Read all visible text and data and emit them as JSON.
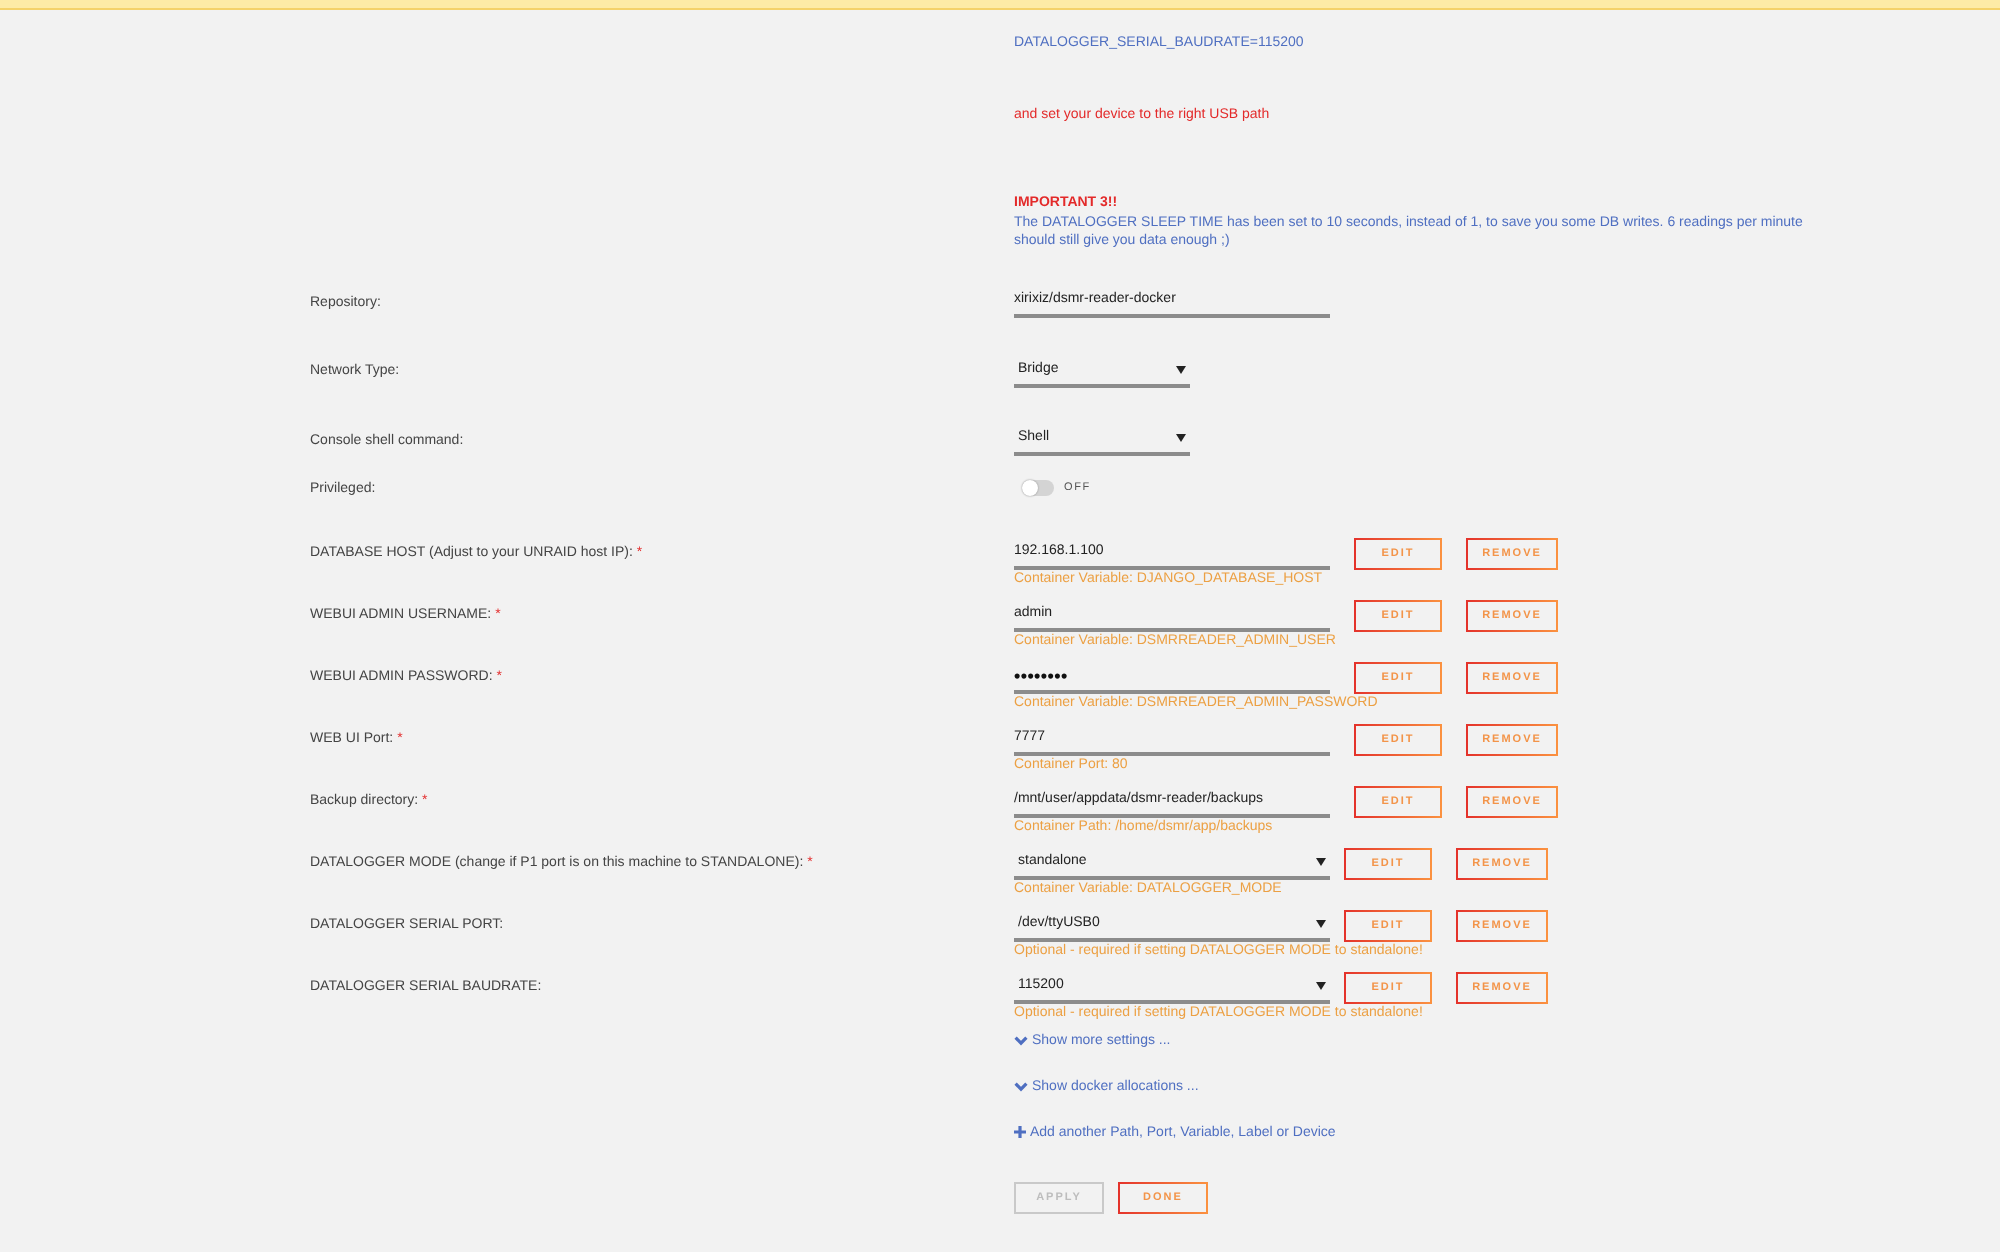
{
  "notes": [
    {
      "kind": "setting",
      "text": "DATALOGGER_SERIAL_BAUDRATE=115200"
    },
    {
      "kind": "warning",
      "text": "and set your device to the right USB path"
    },
    {
      "kind": "heading",
      "text": "IMPORTANT 3!!"
    },
    {
      "kind": "text",
      "text": "The DATALOGGER SLEEP TIME has been set to 10 seconds, instead of 1, to save you some DB writes. 6 readings per minute should still give you data enough ;)"
    }
  ],
  "settings": [
    {
      "label": "Repository:",
      "kind": "text",
      "value": "xirixiz/dsmr-reader-docker"
    },
    {
      "label": "Network Type:",
      "kind": "select",
      "value": "Bridge"
    },
    {
      "label": "Console shell command:",
      "kind": "select",
      "value": "Shell"
    },
    {
      "label": "Privileged:",
      "kind": "toggle",
      "on": false,
      "state_label": "OFF"
    }
  ],
  "variables": [
    {
      "label": "DATABASE HOST (Adjust to your UNRAID host IP):",
      "required_mark": "*",
      "kind": "text",
      "value": "192.168.1.100",
      "note": "Container Variable: DJANGO_DATABASE_HOST",
      "buttons": [
        "EDIT",
        "REMOVE"
      ]
    },
    {
      "label": "WEBUI ADMIN USERNAME:",
      "required_mark": "*",
      "kind": "text",
      "value": "admin",
      "note": "Container Variable: DSMRREADER_ADMIN_USER",
      "buttons": [
        "EDIT",
        "REMOVE"
      ]
    },
    {
      "label": "WEBUI ADMIN PASSWORD:",
      "required_mark": "*",
      "kind": "password",
      "value": "••••••••",
      "note": "Container Variable: DSMRREADER_ADMIN_PASSWORD",
      "buttons": [
        "EDIT",
        "REMOVE"
      ]
    },
    {
      "label": "WEB UI Port:",
      "required_mark": "*",
      "kind": "text",
      "value": "7777",
      "note": "Container Port: 80",
      "buttons": [
        "EDIT",
        "REMOVE"
      ]
    },
    {
      "label": "Backup directory:",
      "required_mark": "*",
      "kind": "text",
      "value": "/mnt/user/appdata/dsmr-reader/backups",
      "note": "Container Path: /home/dsmr/app/backups",
      "buttons": [
        "EDIT",
        "REMOVE"
      ]
    },
    {
      "label": "DATALOGGER MODE (change if P1 port is on this machine to STANDALONE):",
      "required_mark": "*",
      "kind": "select",
      "value": "standalone",
      "note": "Container Variable: DATALOGGER_MODE",
      "buttons": [
        "EDIT",
        "REMOVE"
      ]
    },
    {
      "label": "DATALOGGER SERIAL PORT:",
      "kind": "select",
      "value": "/dev/ttyUSB0",
      "note": "Optional - required if setting DATALOGGER MODE to standalone!",
      "buttons": [
        "EDIT",
        "REMOVE"
      ]
    },
    {
      "label": "DATALOGGER SERIAL BAUDRATE:",
      "kind": "select",
      "value": "115200",
      "note": "Optional - required if setting DATALOGGER MODE to standalone!",
      "buttons": [
        "EDIT",
        "REMOVE"
      ]
    }
  ],
  "links": [
    {
      "kind": "expand",
      "label": "Show more settings ..."
    },
    {
      "kind": "expand",
      "label": "Show docker allocations ..."
    },
    {
      "kind": "add",
      "label": "Add another Path, Port, Variable, Label or Device"
    }
  ],
  "actions": [
    {
      "label": "APPLY",
      "disabled": true
    },
    {
      "label": "DONE",
      "disabled": false
    }
  ]
}
